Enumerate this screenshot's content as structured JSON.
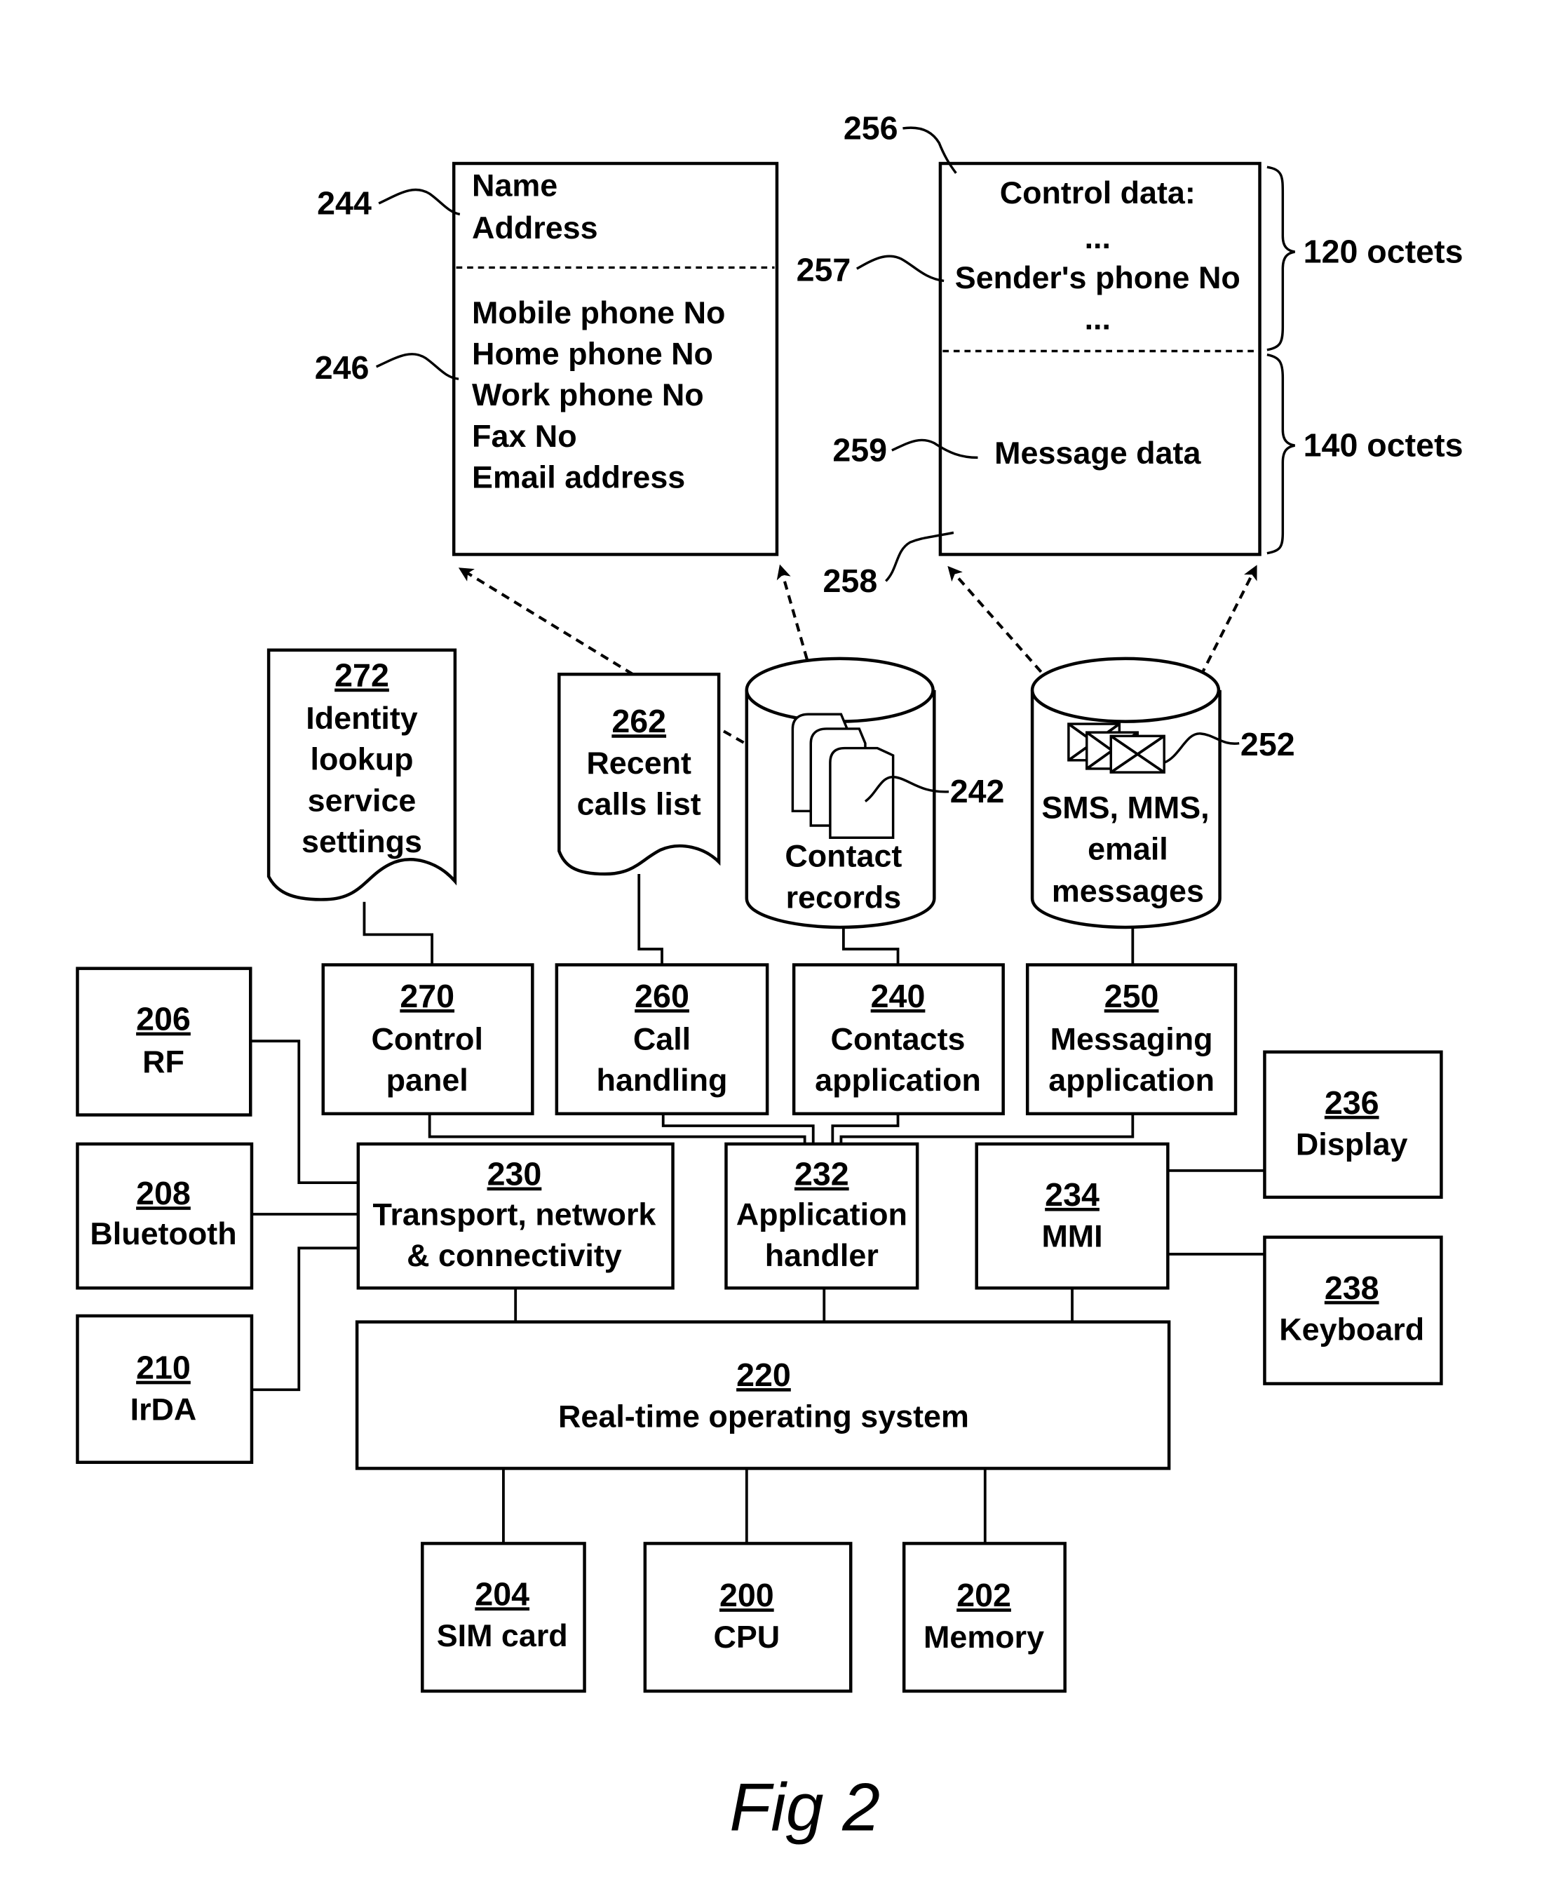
{
  "figure_label": "Fig 2",
  "contact_record": {
    "fields_top": [
      "Name",
      "Address"
    ],
    "fields_bottom": [
      "Mobile phone No",
      "Home phone No",
      "Work phone No",
      "Fax No",
      "Email address"
    ],
    "ref_top": "244",
    "ref_bottom": "246"
  },
  "sms_message": {
    "ref_block": "256",
    "ref_sender": "257",
    "ref_end": "258",
    "ref_message": "259",
    "control_title": "Control data:",
    "ellipsis": "...",
    "sender_field": "Sender's phone No",
    "message_field": "Message data",
    "size_control": "120 octets",
    "size_message": "140 octets"
  },
  "documents": {
    "identity_lookup": {
      "num": "272",
      "lines": [
        "Identity",
        "lookup",
        "service",
        "settings"
      ]
    },
    "recent_calls": {
      "num": "262",
      "lines": [
        "Recent",
        "calls list"
      ]
    }
  },
  "databases": {
    "contacts": {
      "ref": "242",
      "lines": [
        "Contact",
        "records"
      ]
    },
    "messages": {
      "ref": "252",
      "lines": [
        "SMS, MMS,",
        "email",
        "messages"
      ]
    }
  },
  "apps": {
    "control_panel": {
      "num": "270",
      "lines": [
        "Control",
        "panel"
      ]
    },
    "call_handling": {
      "num": "260",
      "lines": [
        "Call",
        "handling"
      ]
    },
    "contacts_app": {
      "num": "240",
      "lines": [
        "Contacts",
        "application"
      ]
    },
    "messaging_app": {
      "num": "250",
      "lines": [
        "Messaging",
        "application"
      ]
    }
  },
  "middleware": {
    "transport": {
      "num": "230",
      "lines": [
        "Transport, network",
        "& connectivity"
      ]
    },
    "app_handler": {
      "num": "232",
      "lines": [
        "Application",
        "handler"
      ]
    },
    "mmi": {
      "num": "234",
      "lines": [
        "MMI"
      ]
    }
  },
  "radios": {
    "rf": {
      "num": "206",
      "lines": [
        "RF"
      ]
    },
    "bluetooth": {
      "num": "208",
      "lines": [
        "Bluetooth"
      ]
    },
    "irda": {
      "num": "210",
      "lines": [
        "IrDA"
      ]
    }
  },
  "io": {
    "display": {
      "num": "236",
      "lines": [
        "Display"
      ]
    },
    "keyboard": {
      "num": "238",
      "lines": [
        "Keyboard"
      ]
    }
  },
  "rtos": {
    "num": "220",
    "lines": [
      "Real-time operating system"
    ]
  },
  "hardware": {
    "sim": {
      "num": "204",
      "lines": [
        "SIM card"
      ]
    },
    "cpu": {
      "num": "200",
      "lines": [
        "CPU"
      ]
    },
    "memory": {
      "num": "202",
      "lines": [
        "Memory"
      ]
    }
  }
}
